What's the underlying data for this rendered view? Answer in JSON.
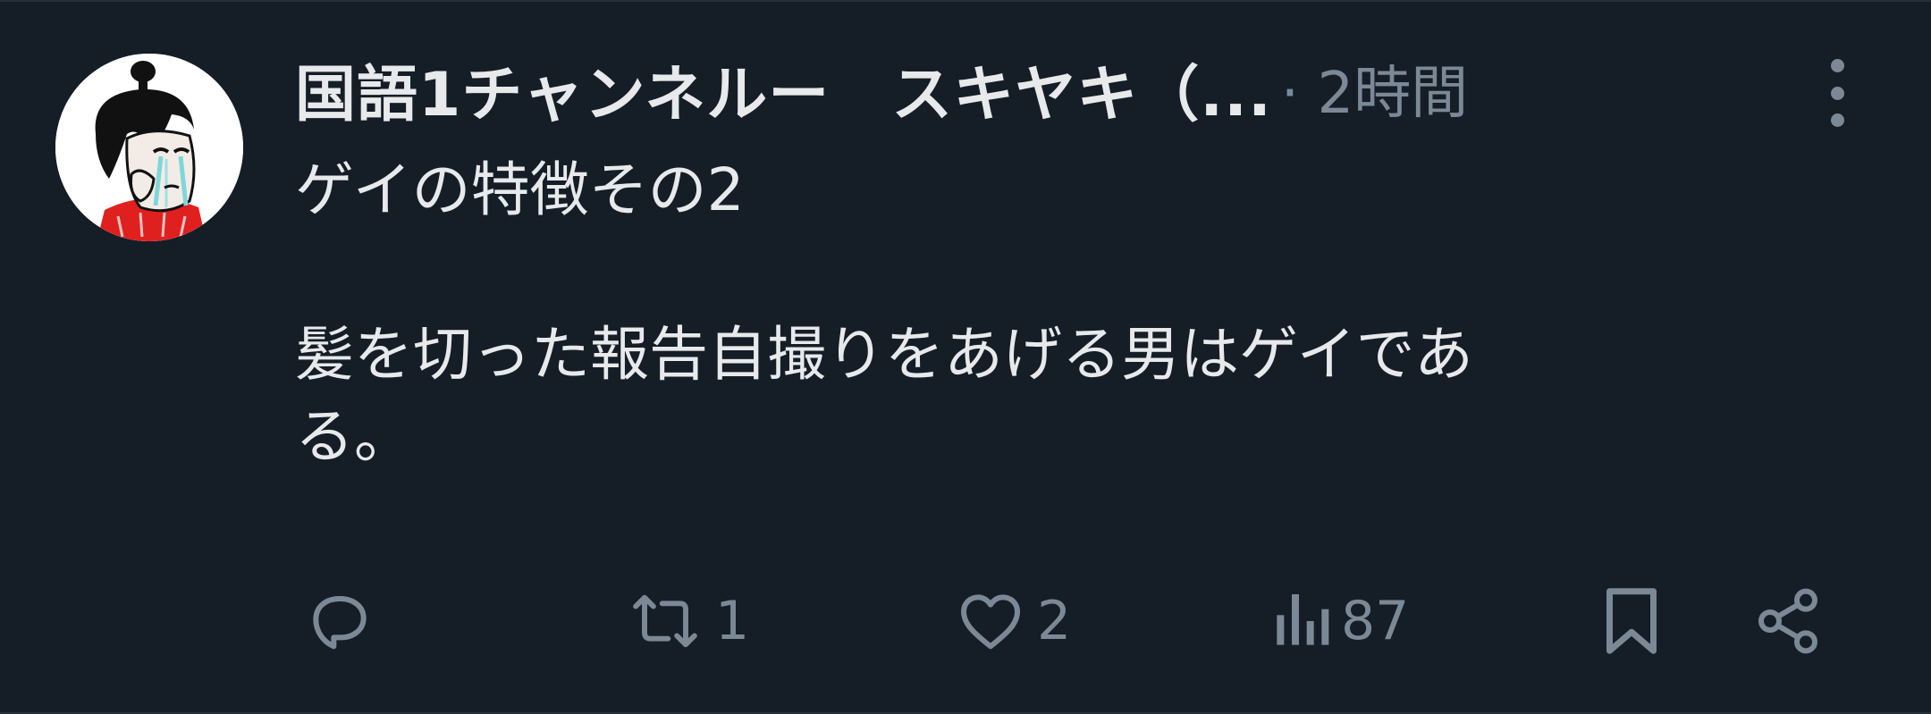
{
  "post": {
    "display_name": "国語1チャンネルー　スキヤキ（...",
    "meta": "· 2時間",
    "body_lines": [
      "ゲイの特徴その2",
      "",
      "髪を切った報告自撮りをあげる男はゲイであ",
      "る。"
    ]
  },
  "actions": {
    "reply_count": "",
    "repost_count": "1",
    "like_count": "2",
    "views_count": "87"
  },
  "icons": {
    "more": "more-vertical-icon",
    "reply": "reply-icon",
    "repost": "repost-icon",
    "like": "heart-icon",
    "views": "views-icon",
    "bookmark": "bookmark-icon",
    "share": "share-icon"
  },
  "colors": {
    "background": "#151d27",
    "text": "#e7e9ea",
    "secondary_text": "#7b8996"
  }
}
